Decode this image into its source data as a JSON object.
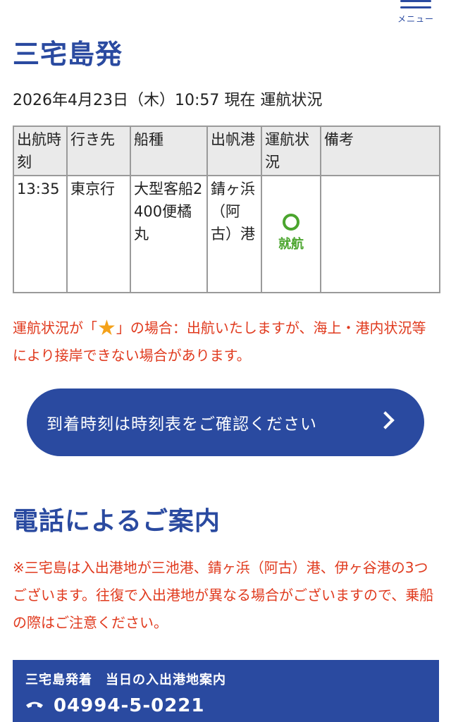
{
  "header": {
    "menu_label": "メニュー"
  },
  "page": {
    "title": "三宅島発",
    "status_line": "2026年4月23日（木）10:57 現在 運航状況"
  },
  "table": {
    "headers": [
      "出航時刻",
      "行き先",
      "船種",
      "出帆港",
      "運航状況",
      "備考"
    ],
    "rows": [
      {
        "time": "13:35",
        "destination": "東京行",
        "ship": "大型客船2400便橘丸",
        "port": "錆ヶ浜（阿古）港",
        "status_symbol": "circle-icon",
        "status": "就航",
        "remarks": ""
      }
    ]
  },
  "notice": {
    "prefix": "運航状況が「",
    "star_symbol": "★",
    "suffix": "」の場合：出航いたしますが、海上・港内状況等により接岸できない場合があります。"
  },
  "arrival_button": {
    "label": "到着時刻は時刻表をご確認ください"
  },
  "phone_section": {
    "title": "電話によるご案内",
    "notice": "※三宅島は入出港地が三池港、錆ヶ浜（阿古）港、伊ヶ谷港の3つございます。往復で入出港地が異なる場合がございますので、乗船の際はご注意ください。",
    "panel_title": "三宅島発着　当日の入出港地案内",
    "phone_number": "04994-5-0221"
  },
  "colors": {
    "brand_blue": "#2a4aa0",
    "notice_red": "#e03a1e",
    "status_green": "#4ba52e",
    "star_orange": "#f4a21a"
  }
}
